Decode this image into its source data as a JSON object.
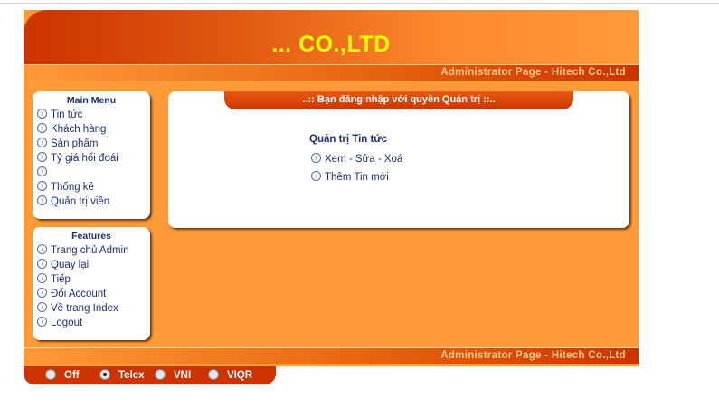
{
  "header": {
    "title": "... CO.,LTD"
  },
  "admin_bar": {
    "text": "Administrator Page - Hitech Co.,Ltd"
  },
  "main_menu": {
    "title": "Main Menu",
    "items": [
      {
        "label": "Tin tức"
      },
      {
        "label": "Khách hàng"
      },
      {
        "label": "Sản phẩm"
      },
      {
        "label": "Tỷ giá hối đoái"
      },
      {
        "label": ""
      },
      {
        "label": "Thống kê"
      },
      {
        "label": "Quản trị viên"
      }
    ]
  },
  "features": {
    "title": "Features",
    "items": [
      {
        "label": "Trang chủ Admin"
      },
      {
        "label": "Quay lại"
      },
      {
        "label": "Tiếp"
      },
      {
        "label": "Đổi Account"
      },
      {
        "label": "Về trang Index"
      },
      {
        "label": "Logout"
      }
    ]
  },
  "content": {
    "tab_title": "..:: Bạn đăng nhập với quyền Quản trị ::..",
    "section_title": "Quản trị Tin tức",
    "links": [
      {
        "label": "Xem - Sửa - Xoá"
      },
      {
        "label": "Thêm Tin mới"
      }
    ]
  },
  "input_method": {
    "options": [
      {
        "label": "Off",
        "selected": false
      },
      {
        "label": "Telex",
        "selected": true
      },
      {
        "label": "VNI",
        "selected": false
      },
      {
        "label": "VIQR",
        "selected": false
      }
    ]
  },
  "colors": {
    "brand_dark": "#cc3300",
    "brand_orange": "#ff9a38",
    "title_yellow": "#ffff00",
    "link_navy": "#1d2f7a"
  }
}
